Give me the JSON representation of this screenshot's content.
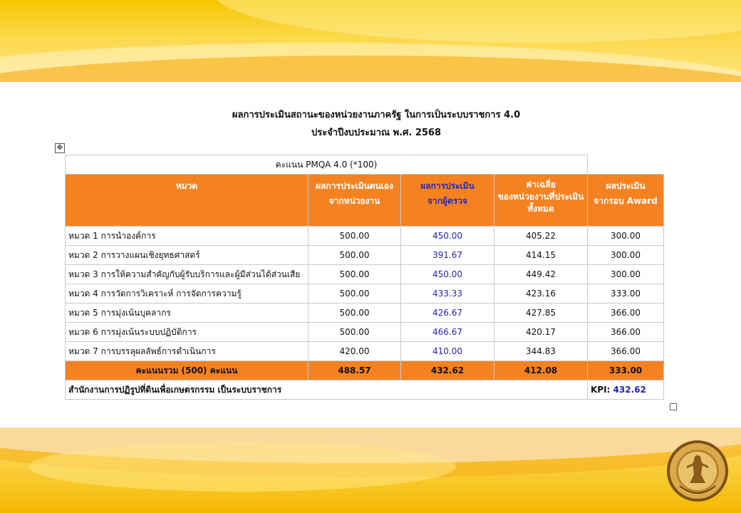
{
  "title_line1": "ผลการประเมินสถานะของหน่วยงานภาครัฐ ในการเป็นระบบราชการ 4.0",
  "title_line2": "ประจำปีงบประมาณ พ.ศ. 2568",
  "table": {
    "caption": "คะแนน PMQA 4.0 (*100)",
    "headers": {
      "category": "หมวด",
      "self_1": "ผลการประเมินตนเอง",
      "self_2": "จากหน่วยงาน",
      "examiner_1": "ผลการประเมิน",
      "examiner_2": "จากผู้ตรวจ",
      "avg_1": "ค่าเฉลี่ย",
      "avg_2": "ของหน่วยงานที่ประเมิน",
      "avg_3": "ทั้งหมด",
      "award_1": "ผลประเมิน",
      "award_2": "จากรอบ Award"
    },
    "rows": [
      {
        "category": "หมวด 1 การนำองค์การ",
        "self": "500.00",
        "examiner": "450.00",
        "avg": "405.22",
        "award": "300.00"
      },
      {
        "category": "หมวด 2 การวางแผนเชิงยุทธศาสตร์",
        "self": "500.00",
        "examiner": "391.67",
        "avg": "414.15",
        "award": "300.00"
      },
      {
        "category": "หมวด 3 การให้ความสำคัญกับผู้รับบริการและผู้มีส่วนได้ส่วนเสีย",
        "self": "500.00",
        "examiner": "450.00",
        "avg": "449.42",
        "award": "300.00"
      },
      {
        "category": "หมวด 4 การวัดการวิเคราะห์ การจัดการความรู้",
        "self": "500.00",
        "examiner": "433.33",
        "avg": "423.16",
        "award": "333.00"
      },
      {
        "category": "หมวด 5 การมุ่งเน้นบุคลากร",
        "self": "500.00",
        "examiner": "426.67",
        "avg": "427.85",
        "award": "366.00"
      },
      {
        "category": "หมวด 6 การมุ่งเน้นระบบปฏิบัติการ",
        "self": "500.00",
        "examiner": "466.67",
        "avg": "420.17",
        "award": "366.00"
      },
      {
        "category": "หมวด 7 การบรรลุผลลัพธ์การดำเนินการ",
        "self": "420.00",
        "examiner": "410.00",
        "avg": "344.83",
        "award": "366.00"
      }
    ],
    "total": {
      "label": "คะแนนรวม (500) คะแนน",
      "self": "488.57",
      "examiner": "432.62",
      "avg": "412.08",
      "award": "333.00"
    },
    "footer": {
      "agency": "สำนักงานการปฏิรูปที่ดินเพื่อเกษตรกรรม เป็นระบบราชการ",
      "kpi_label": "KPI:",
      "kpi_value": "432.62"
    }
  },
  "colors": {
    "header_orange": "#f58220",
    "examiner_blue": "#1f1fc0",
    "banner_yellow": "#f7c600"
  },
  "icons": {
    "move": "move-handle-icon",
    "seal": "agency-seal-logo"
  }
}
